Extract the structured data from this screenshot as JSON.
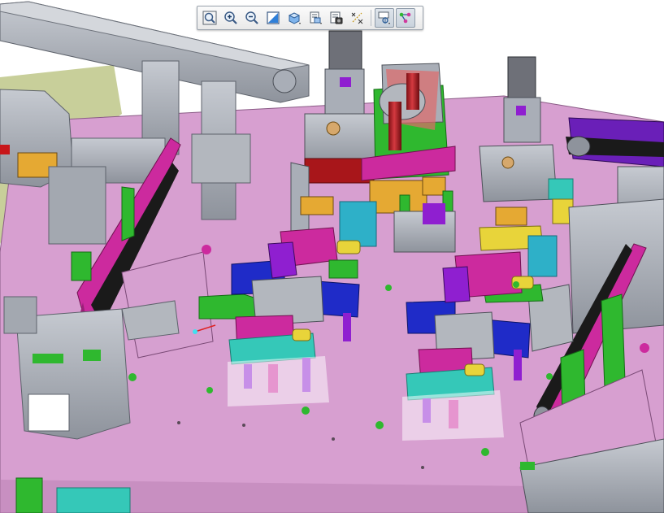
{
  "window": {
    "type": "cad-3d-viewport"
  },
  "toolbar": {
    "buttons": [
      {
        "id": "zoom-fit",
        "icon": "zoom-fit-icon",
        "active": false
      },
      {
        "id": "zoom-in",
        "icon": "zoom-in-icon",
        "active": false
      },
      {
        "id": "zoom-out",
        "icon": "zoom-out-icon",
        "active": false
      },
      {
        "id": "repaint",
        "icon": "repaint-icon",
        "active": false
      },
      {
        "id": "display-style",
        "icon": "display-style-icon",
        "active": false
      },
      {
        "id": "saved-views",
        "icon": "saved-views-icon",
        "active": false
      },
      {
        "id": "view-manager",
        "icon": "view-manager-icon",
        "active": false
      },
      {
        "id": "datum-display",
        "icon": "datum-display-icon",
        "active": false
      },
      {
        "id": "spin-center",
        "icon": "spin-center-icon",
        "active": true
      },
      {
        "id": "annotation-display",
        "icon": "annotation-display-icon",
        "active": true
      }
    ]
  },
  "colors": {
    "base_plate": "#d79fd0",
    "steel_grey": "#a9aeb7",
    "green": "#2fb82f",
    "magenta": "#cc2a9e",
    "blue": "#1f2bc8",
    "teal": "#35c8b8",
    "yellow": "#e8d43a",
    "dark_red": "#a8161a",
    "purple": "#6a1fb8",
    "black_belt": "#1a1a1a",
    "floor": "#c8cf9a"
  }
}
